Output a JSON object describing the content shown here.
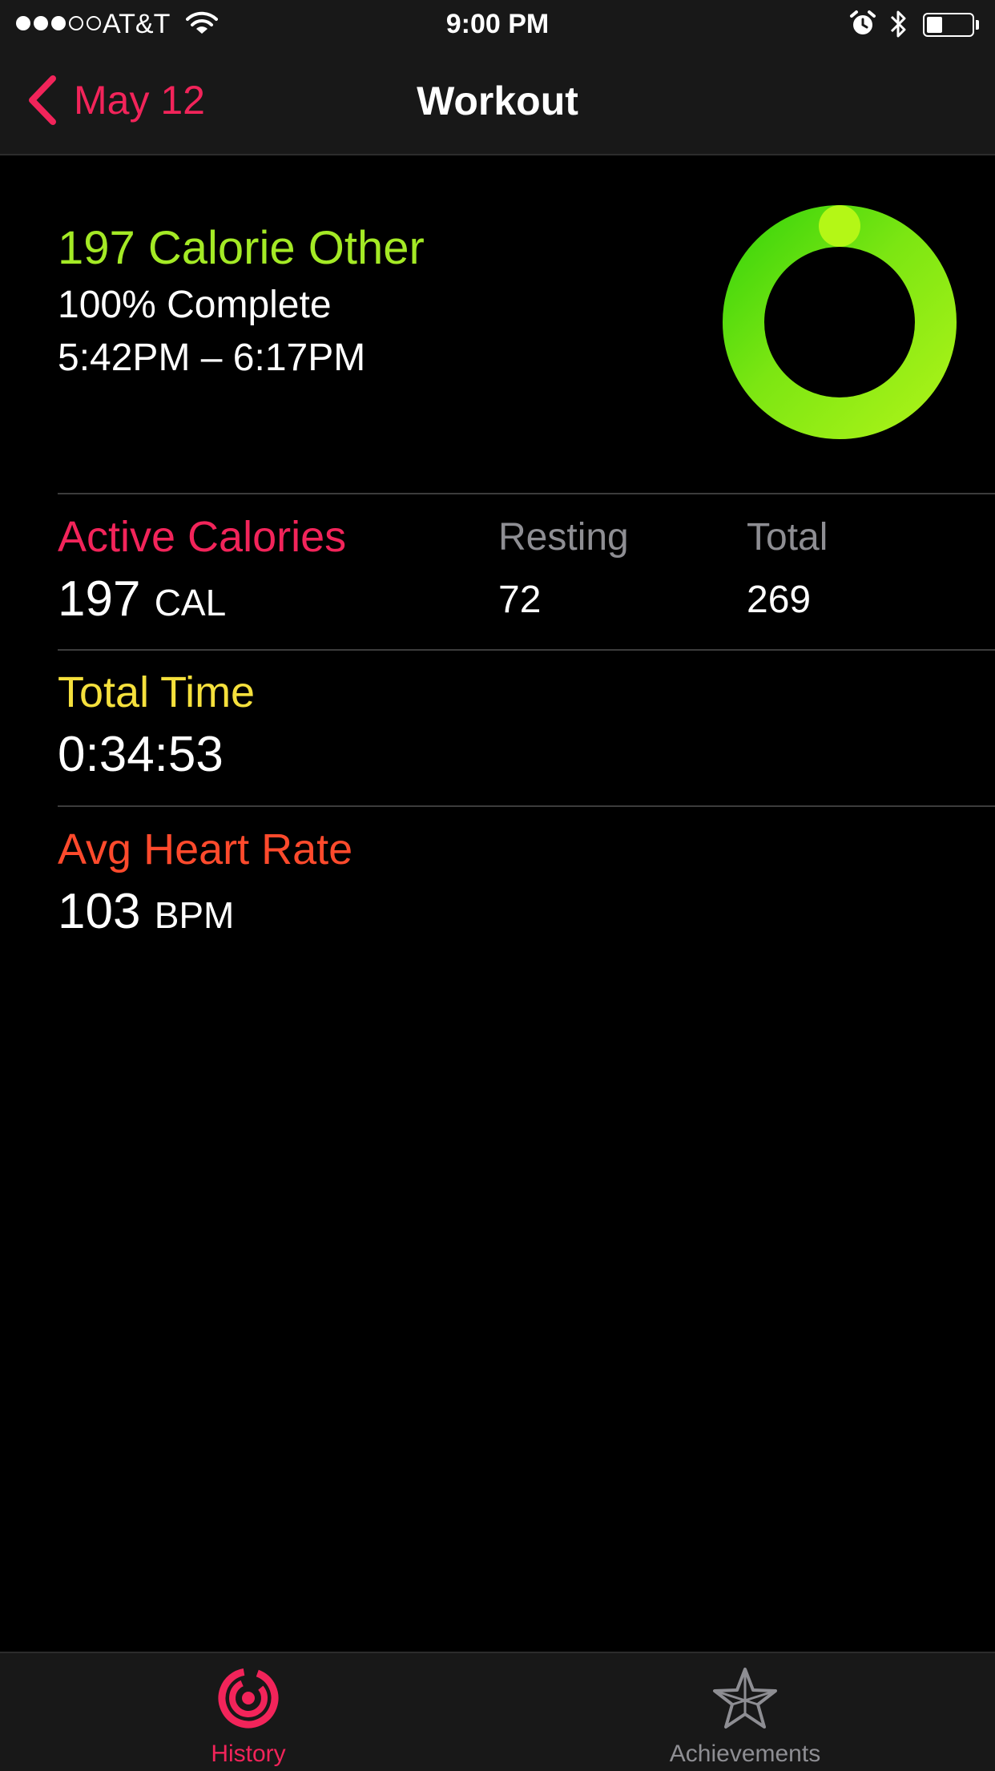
{
  "status_bar": {
    "carrier": "AT&T",
    "time": "9:00 PM",
    "signal_bars_filled": 3,
    "signal_bars_total": 5,
    "battery_level": 0.36
  },
  "nav": {
    "back_label": "May 12",
    "title": "Workout"
  },
  "summary": {
    "title": "197 Calorie Other",
    "progress_text": "100% Complete",
    "time_range": "5:42PM – 6:17PM",
    "ring_progress": 1.0
  },
  "metrics": {
    "active_calories": {
      "label": "Active Calories",
      "value": "197",
      "unit": "CAL"
    },
    "resting": {
      "label": "Resting",
      "value": "72"
    },
    "total": {
      "label": "Total",
      "value": "269"
    },
    "total_time": {
      "label": "Total Time",
      "value": "0:34:53"
    },
    "heart_rate": {
      "label": "Avg Heart Rate",
      "value": "103",
      "unit": "BPM"
    }
  },
  "tabs": [
    {
      "label": "History",
      "icon": "history-icon",
      "selected": true
    },
    {
      "label": "Achievements",
      "icon": "star-icon",
      "selected": false
    }
  ],
  "colors": {
    "accent": "#f2245a",
    "goal_green": "#a4ea25",
    "time_yellow": "#f5e03c",
    "heart_red": "#ff4a2c",
    "muted": "#8e8e93"
  }
}
